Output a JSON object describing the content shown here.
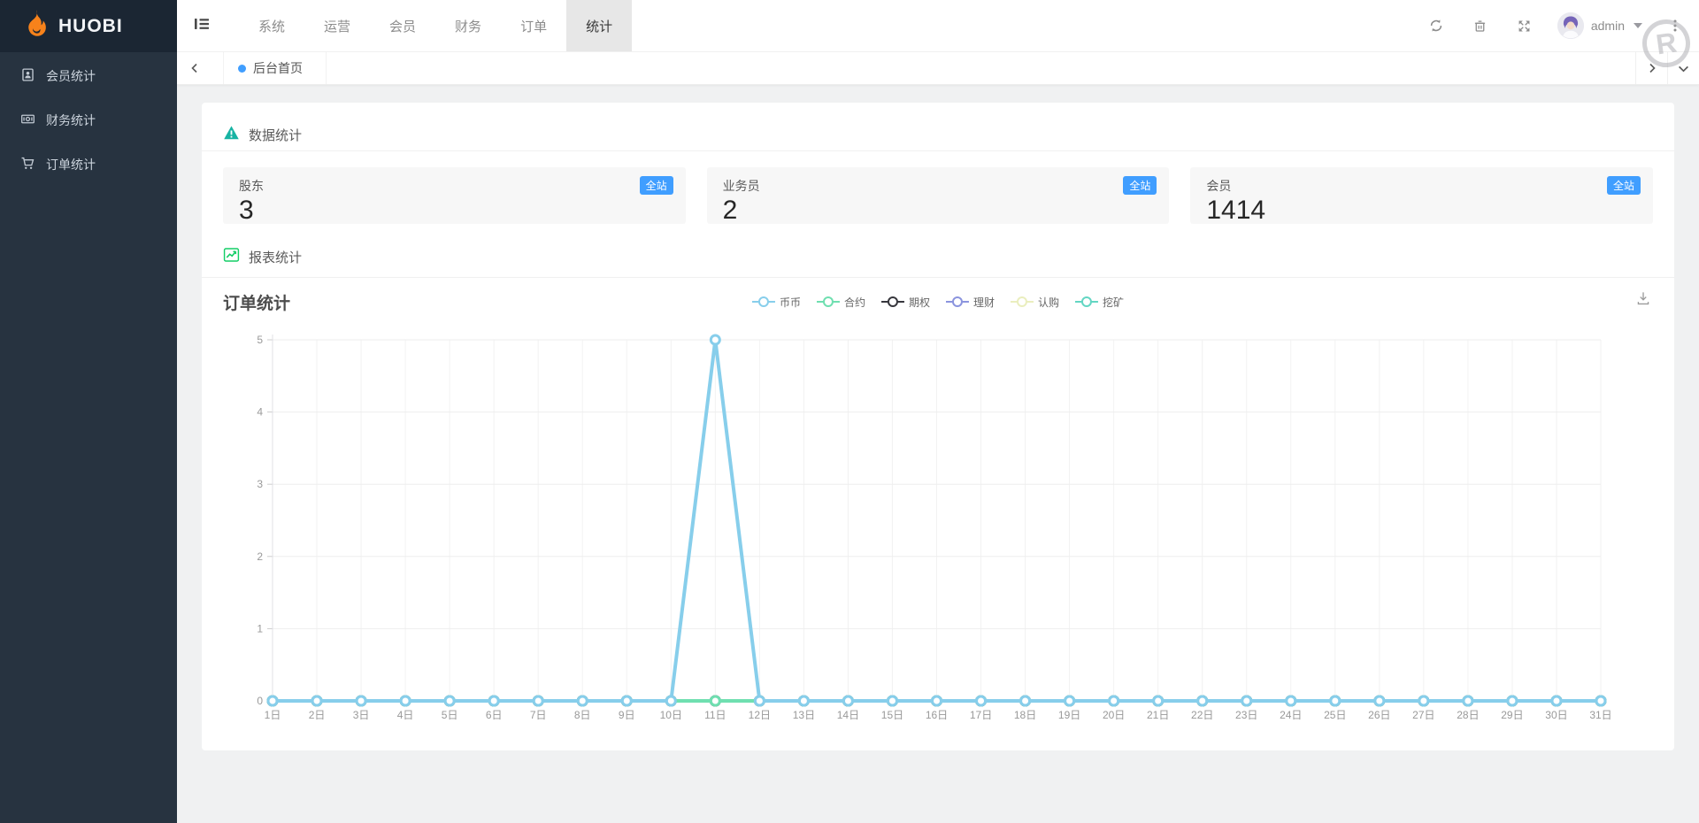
{
  "brand": {
    "name": "HUOBI"
  },
  "sidebar": {
    "items": [
      {
        "label": "会员统计",
        "icon": "id-card-icon"
      },
      {
        "label": "财务统计",
        "icon": "banknote-icon"
      },
      {
        "label": "订单统计",
        "icon": "cart-icon"
      }
    ]
  },
  "topnav": {
    "items": [
      {
        "label": "系统",
        "active": false
      },
      {
        "label": "运营",
        "active": false
      },
      {
        "label": "会员",
        "active": false
      },
      {
        "label": "财务",
        "active": false
      },
      {
        "label": "订单",
        "active": false
      },
      {
        "label": "统计",
        "active": true
      }
    ]
  },
  "user": {
    "name": "admin"
  },
  "tabs": {
    "active_tab": "后台首页"
  },
  "watermark_letter": "R",
  "sections": {
    "data_stats_title": "数据统计",
    "report_stats_title": "报表统计"
  },
  "stats": {
    "badge_label": "全站",
    "cards": [
      {
        "label": "股东",
        "value": "3"
      },
      {
        "label": "业务员",
        "value": "2"
      },
      {
        "label": "会员",
        "value": "1414"
      }
    ]
  },
  "chart_data": {
    "type": "line",
    "title": "订单统计",
    "xlabel": "",
    "ylabel": "",
    "ylim": [
      0,
      5
    ],
    "yticks": [
      0,
      1,
      2,
      3,
      4,
      5
    ],
    "grid": true,
    "legend_position": "top-center",
    "categories": [
      "1日",
      "2日",
      "3日",
      "4日",
      "5日",
      "6日",
      "7日",
      "8日",
      "9日",
      "10日",
      "11日",
      "12日",
      "13日",
      "14日",
      "15日",
      "16日",
      "17日",
      "18日",
      "19日",
      "20日",
      "21日",
      "22日",
      "23日",
      "24日",
      "25日",
      "26日",
      "27日",
      "28日",
      "29日",
      "30日",
      "31日"
    ],
    "series": [
      {
        "name": "币币",
        "color": "#87ceeb",
        "values": [
          0,
          0,
          0,
          0,
          0,
          0,
          0,
          0,
          0,
          0,
          5,
          0,
          0,
          0,
          0,
          0,
          0,
          0,
          0,
          0,
          0,
          0,
          0,
          0,
          0,
          0,
          0,
          0,
          0,
          0,
          0
        ]
      },
      {
        "name": "合约",
        "color": "#6fdfb0",
        "values": [
          0,
          0,
          0,
          0,
          0,
          0,
          0,
          0,
          0,
          0,
          0,
          0,
          0,
          0,
          0,
          0,
          0,
          0,
          0,
          0,
          0,
          0,
          0,
          0,
          0,
          0,
          0,
          0,
          0,
          0,
          0
        ]
      },
      {
        "name": "期权",
        "color": "#37373d",
        "values": [
          0,
          0,
          0,
          0,
          0,
          0,
          0,
          0,
          0,
          0,
          0,
          0,
          0,
          0,
          0,
          0,
          0,
          0,
          0,
          0,
          0,
          0,
          0,
          0,
          0,
          0,
          0,
          0,
          0,
          0,
          0
        ]
      },
      {
        "name": "理财",
        "color": "#8b94de",
        "values": [
          0,
          0,
          0,
          0,
          0,
          0,
          0,
          0,
          0,
          0,
          0,
          0,
          0,
          0,
          0,
          0,
          0,
          0,
          0,
          0,
          0,
          0,
          0,
          0,
          0,
          0,
          0,
          0,
          0,
          0,
          0
        ]
      },
      {
        "name": "认购",
        "color": "#eaeebe",
        "values": [
          0,
          0,
          0,
          0,
          0,
          0,
          0,
          0,
          0,
          0,
          0,
          0,
          0,
          0,
          0,
          0,
          0,
          0,
          0,
          0,
          0,
          0,
          0,
          0,
          0,
          0,
          0,
          0,
          0,
          0,
          0
        ]
      },
      {
        "name": "挖矿",
        "color": "#63d6c3",
        "values": [
          0,
          0,
          0,
          0,
          0,
          0,
          0,
          0,
          0,
          0,
          0,
          0,
          0,
          0,
          0,
          0,
          0,
          0,
          0,
          0,
          0,
          0,
          0,
          0,
          0,
          0,
          0,
          0,
          0,
          0,
          0
        ]
      }
    ]
  }
}
